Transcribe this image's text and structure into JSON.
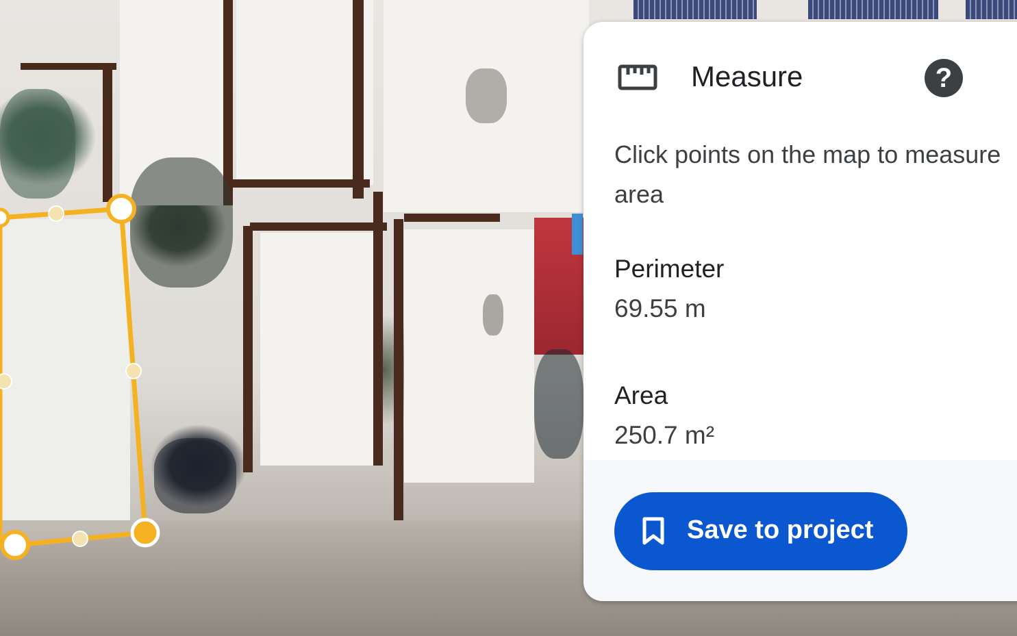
{
  "panel": {
    "title": "Measure",
    "icon": "ruler-icon",
    "help_icon": "help-icon",
    "help_glyph": "?",
    "instructions": "Click points on the map to measure area",
    "perimeter": {
      "label": "Perimeter",
      "value": "69.55 m"
    },
    "area": {
      "label": "Area",
      "value": "250.7 m²"
    },
    "save_button": {
      "label": "Save to project",
      "icon": "bookmark-icon"
    }
  },
  "colors": {
    "measure_outline": "#f4b223",
    "accent": "#0b57d0",
    "help_icon_bg": "#3c4043"
  }
}
